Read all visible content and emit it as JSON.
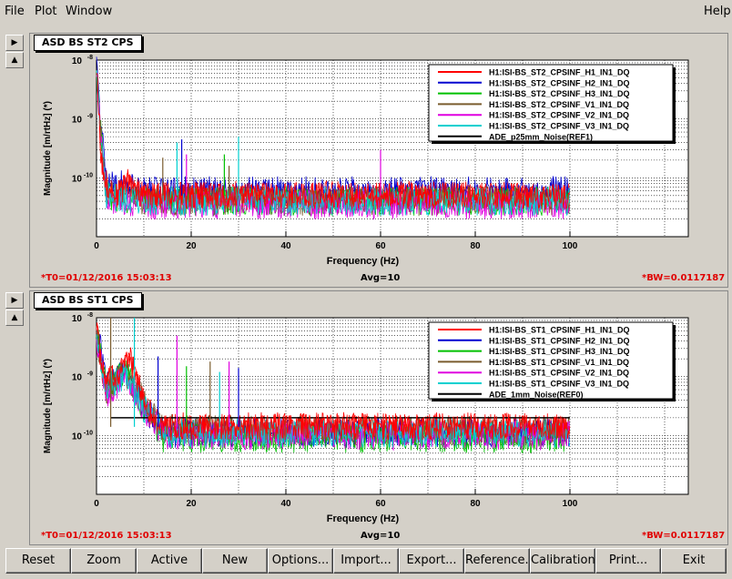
{
  "menu": {
    "file": "File",
    "plot": "Plot",
    "window": "Window",
    "help": "Help"
  },
  "side_buttons": {
    "expand": "▶",
    "collapse": "▲"
  },
  "panels": [
    {
      "title": "ASD BS ST2 CPS",
      "t0": "*T0=01/12/2016 15:03:13",
      "avg": "Avg=10",
      "bw": "*BW=0.0117187"
    },
    {
      "title": "ASD BS ST1 CPS",
      "t0": "*T0=01/12/2016 15:03:13",
      "avg": "Avg=10",
      "bw": "*BW=0.0117187"
    }
  ],
  "buttons": [
    "Reset",
    "Zoom",
    "Active",
    "New",
    "Options...",
    "Import...",
    "Export...",
    "Reference...",
    "Calibration...",
    "Print...",
    "Exit"
  ],
  "colors": {
    "H1": "#ff0000",
    "H2": "#0000d0",
    "H3": "#00c000",
    "V1": "#7a5c2e",
    "V2": "#e000e0",
    "V3": "#00d0d0",
    "REF": "#000000"
  },
  "chart_data": [
    {
      "type": "line",
      "title": "ASD BS ST2 CPS",
      "xlabel": "Frequency (Hz)",
      "ylabel": "Magnitude [m/rtHz] (*)",
      "xlim": [
        0,
        125
      ],
      "ylim": [
        1e-11,
        1e-08
      ],
      "yscale": "log",
      "grid": true,
      "legend_position": "top-right",
      "x_ticks": [
        0,
        20,
        40,
        60,
        80,
        100
      ],
      "y_ticks": [
        1e-10,
        1e-09,
        1e-08
      ],
      "y_tick_labels": [
        "10^-10",
        "10^-9",
        "10^-8"
      ],
      "series": [
        {
          "name": "H1:ISI-BS_ST2_CPSINF_H1_IN1_DQ",
          "color_key": "H1",
          "x": [
            0,
            1,
            2,
            4,
            6,
            7,
            8,
            10,
            20,
            40,
            60,
            80,
            100
          ],
          "y": [
            1e-08,
            2e-10,
            8e-11,
            5e-11,
            7e-11,
            9e-11,
            6e-11,
            5e-11,
            5e-11,
            5e-11,
            5e-11,
            5e-11,
            5e-11
          ]
        },
        {
          "name": "H1:ISI-BS_ST2_CPSINF_H2_IN1_DQ",
          "color_key": "H2",
          "x": [
            0,
            2,
            10,
            20,
            40,
            60,
            80,
            100
          ],
          "y": [
            8e-09,
            9e-11,
            6e-11,
            6e-11,
            6e-11,
            6e-11,
            6e-11,
            6e-11
          ]
        },
        {
          "name": "H1:ISI-BS_ST2_CPSINF_H3_IN1_DQ",
          "color_key": "H3",
          "x": [
            0,
            2,
            10,
            20,
            40,
            60,
            80,
            100
          ],
          "y": [
            6e-09,
            5e-11,
            4e-11,
            4e-11,
            4e-11,
            4e-11,
            4e-11,
            4e-11
          ]
        },
        {
          "name": "H1:ISI-BS_ST2_CPSINF_V1_IN1_DQ",
          "color_key": "V1",
          "x": [
            0,
            2,
            10,
            20,
            40,
            60,
            80,
            100
          ],
          "y": [
            5e-09,
            5e-11,
            4e-11,
            4e-11,
            4e-11,
            4e-11,
            4e-11,
            4e-11
          ]
        },
        {
          "name": "H1:ISI-BS_ST2_CPSINF_V2_IN1_DQ",
          "color_key": "V2",
          "x": [
            0,
            2,
            10,
            20,
            40,
            60,
            80,
            100
          ],
          "y": [
            5e-09,
            4e-11,
            3.5e-11,
            3.5e-11,
            3.5e-11,
            3.5e-11,
            3.5e-11,
            3.5e-11
          ]
        },
        {
          "name": "H1:ISI-BS_ST2_CPSINF_V3_IN1_DQ",
          "color_key": "V3",
          "x": [
            0,
            2,
            10,
            20,
            40,
            60,
            80,
            100
          ],
          "y": [
            5e-09,
            5e-11,
            4e-11,
            4e-11,
            4e-11,
            4e-11,
            4e-11,
            4e-11
          ]
        },
        {
          "name": "ADE_p25mm_Noise(REF1)",
          "color_key": "REF",
          "x": [],
          "y": []
        }
      ],
      "peaks": [
        {
          "x": 14,
          "y": 2.2e-10
        },
        {
          "x": 17,
          "y": 4e-10
        },
        {
          "x": 18,
          "y": 4.5e-10
        },
        {
          "x": 19,
          "y": 2.5e-10
        },
        {
          "x": 27,
          "y": 2.5e-10
        },
        {
          "x": 28,
          "y": 1.6e-10
        },
        {
          "x": 30,
          "y": 5e-10
        },
        {
          "x": 60,
          "y": 3e-10
        }
      ]
    },
    {
      "type": "line",
      "title": "ASD BS ST1 CPS",
      "xlabel": "Frequency (Hz)",
      "ylabel": "Magnitude [m/rtHz] (*)",
      "xlim": [
        0,
        125
      ],
      "ylim": [
        1e-11,
        1e-08
      ],
      "yscale": "log",
      "grid": true,
      "legend_position": "top-right",
      "x_ticks": [
        0,
        20,
        40,
        60,
        80,
        100
      ],
      "y_ticks": [
        1e-10,
        1e-09,
        1e-08
      ],
      "y_tick_labels": [
        "10^-10",
        "10^-9",
        "10^-8"
      ],
      "series": [
        {
          "name": "H1:ISI-BS_ST1_CPSINF_H1_IN1_DQ",
          "color_key": "H1",
          "x": [
            0,
            1,
            2,
            4,
            6,
            7,
            8,
            10,
            12,
            14,
            16,
            18,
            20,
            40,
            60,
            80,
            100
          ],
          "y": [
            1e-08,
            1.5e-09,
            8e-10,
            1e-09,
            1.6e-09,
            2e-09,
            1.2e-09,
            4e-10,
            2e-10,
            1.3e-10,
            1.3e-10,
            1.4e-10,
            1.4e-10,
            1.4e-10,
            1.4e-10,
            1.4e-10,
            1.4e-10
          ]
        },
        {
          "name": "H1:ISI-BS_ST1_CPSINF_H2_IN1_DQ",
          "color_key": "H2",
          "x": [
            0,
            2,
            6,
            10,
            14,
            20,
            40,
            60,
            80,
            100
          ],
          "y": [
            8e-09,
            7e-10,
            1.3e-09,
            3e-10,
            1.1e-10,
            1.1e-10,
            1.1e-10,
            1.1e-10,
            1.1e-10,
            1.1e-10
          ]
        },
        {
          "name": "H1:ISI-BS_ST1_CPSINF_H3_IN1_DQ",
          "color_key": "H3",
          "x": [
            0,
            2,
            6,
            10,
            14,
            20,
            40,
            60,
            80,
            100
          ],
          "y": [
            6e-09,
            6e-10,
            1.2e-09,
            3e-10,
            9e-11,
            9e-11,
            9e-11,
            9e-11,
            9e-11,
            9e-11
          ]
        },
        {
          "name": "H1:ISI-BS_ST1_CPSINF_V1_IN1_DQ",
          "color_key": "V1",
          "x": [
            0,
            2,
            6,
            10,
            14,
            20,
            40,
            60,
            80,
            100
          ],
          "y": [
            5e-09,
            6e-10,
            1.1e-09,
            4e-10,
            1.5e-10,
            1.3e-10,
            1.2e-10,
            1.2e-10,
            1.2e-10,
            1.2e-10
          ]
        },
        {
          "name": "H1:ISI-BS_ST1_CPSINF_V2_IN1_DQ",
          "color_key": "V2",
          "x": [
            0,
            2,
            6,
            10,
            14,
            20,
            40,
            60,
            80,
            100
          ],
          "y": [
            5e-09,
            5e-10,
            1e-09,
            3e-10,
            1e-10,
            1e-10,
            1e-10,
            1e-10,
            1e-10,
            1e-10
          ]
        },
        {
          "name": "H1:ISI-BS_ST1_CPSINF_V3_IN1_DQ",
          "color_key": "V3",
          "x": [
            0,
            2,
            6,
            10,
            14,
            20,
            40,
            60,
            80,
            100
          ],
          "y": [
            5e-09,
            6e-10,
            1.1e-09,
            3e-10,
            1.1e-10,
            1.1e-10,
            1.1e-10,
            1.1e-10,
            1.1e-10,
            1.1e-10
          ]
        },
        {
          "name": "ADE_1mm_Noise(REF0)",
          "color_key": "REF",
          "x": [
            3,
            100
          ],
          "y": [
            2e-10,
            2e-10
          ]
        }
      ],
      "peaks": [
        {
          "x": 3,
          "y": 1e-08
        },
        {
          "x": 8,
          "y": 1e-08
        },
        {
          "x": 13,
          "y": 2.2e-09
        },
        {
          "x": 17,
          "y": 5e-09
        },
        {
          "x": 19,
          "y": 1.5e-09
        },
        {
          "x": 24,
          "y": 1.8e-09
        },
        {
          "x": 26,
          "y": 1.2e-09
        },
        {
          "x": 28,
          "y": 1.8e-09
        },
        {
          "x": 30,
          "y": 1.4e-09
        }
      ]
    }
  ]
}
